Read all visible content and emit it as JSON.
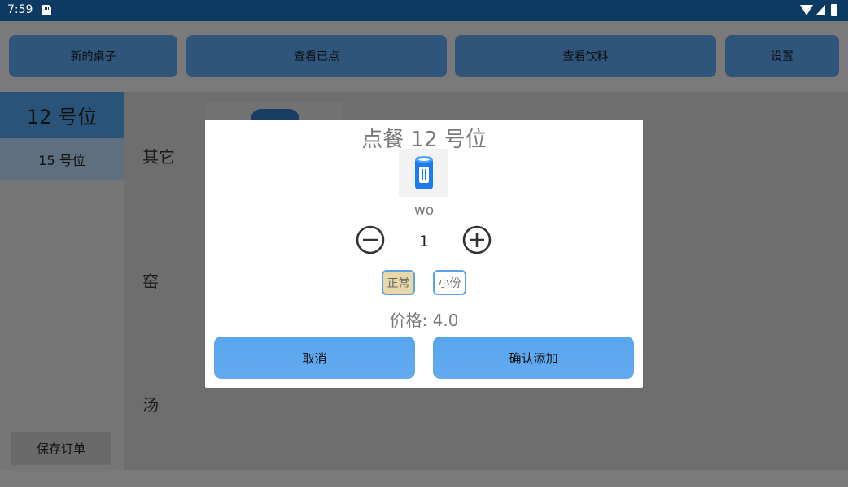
{
  "status_bar": {
    "time": "7:59"
  },
  "top_buttons": {
    "new_table": "新的桌子",
    "view_ordered": "查看已点",
    "view_drinks": "查看饮料",
    "settings": "设置"
  },
  "tables": {
    "selected": "12 号位",
    "other": "15 号位"
  },
  "categories": [
    "其它",
    "窑",
    "汤"
  ],
  "save_order": "保存订单",
  "dialog": {
    "title": "点餐  12 号位",
    "item_name": "wo",
    "quantity": "1",
    "size_normal": "正常",
    "size_small": "小份",
    "price": "价格: 4.0",
    "cancel": "取消",
    "confirm": "确认添加"
  },
  "colors": {
    "accent": "#5ba3e8",
    "status_bar": "#0d3a63",
    "selected_size_bg": "#e9d9a9"
  },
  "icons": {
    "item_thumbnail": "can-icon",
    "minus": "minus-circle-icon",
    "plus": "plus-circle-icon"
  }
}
